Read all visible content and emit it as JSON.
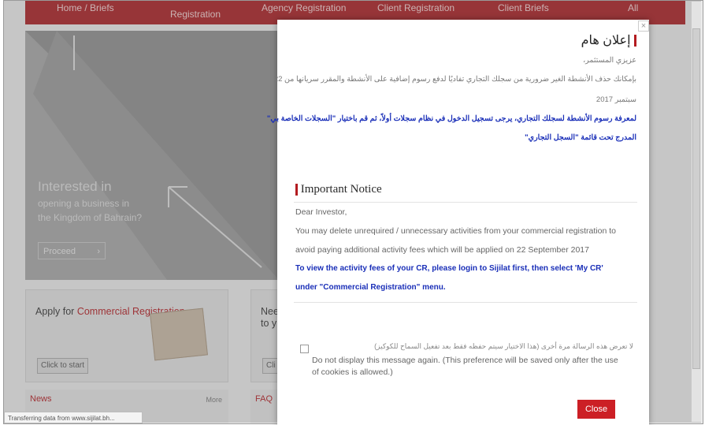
{
  "nav": {
    "items": [
      "Home / Briefs",
      "Registration",
      "Agency Registration",
      "Client Registration",
      "Client Briefs",
      "All"
    ]
  },
  "hero": {
    "line1": "Interested in",
    "line2": "opening a business in",
    "line3": "the Kingdom of Bahrain?",
    "button": "Proceed"
  },
  "promo1": {
    "title_plain": "Apply for ",
    "title_red": "Commercial Registration.",
    "button": "Click to start"
  },
  "promo2": {
    "title": "Nee to y",
    "button": "Cli"
  },
  "footer": {
    "news": "News",
    "more": "More",
    "faq": "FAQ"
  },
  "modal": {
    "ar_title": "إعلان هام",
    "ar_greeting": "عزيزي المستثمر،",
    "ar_body1": "بإمكانك حذف الأنشطة الغير ضرورية من سجلك التجاري تفاديًا لدفع رسوم إضافية على الأنشطة والمقرر سريانها من 22",
    "ar_body2": "سبتمبر 2017",
    "ar_blue1": "لمعرفة رسوم الأنشطة لسجلك التجاري، يرجى تسجيل الدخول في نظام سجلات أولاً، ثم قم باختيار \"السجلات الخاصة بي\"",
    "ar_blue2": "المدرج تحت قائمة \"السجل التجاري\"",
    "en_title": "Important Notice",
    "en_greeting": "Dear Investor,",
    "en_body1": "You may delete unrequired / unnecessary activities from your commercial registration to",
    "en_body2": "avoid paying additional activity fees which will be applied on 22 September 2017",
    "en_blue1": "To view the activity fees of your CR, please login to Sijilat first, then select 'My CR'",
    "en_blue2": "under \"Commercial Registration\" menu.",
    "checkbox_ar": "لا تعرض هذه الرسالة مرة أخرى (هذا الاختيار سيتم حفظه فقط بعد تفعيل السماح للكوكيز)",
    "checkbox_en": "Do not display this message again. (This preference will be saved only after the use of cookies is allowed.)",
    "close_label": "Close",
    "close_x": "×"
  },
  "status": {
    "text": "Transferring data from www.sijilat.bh..."
  }
}
